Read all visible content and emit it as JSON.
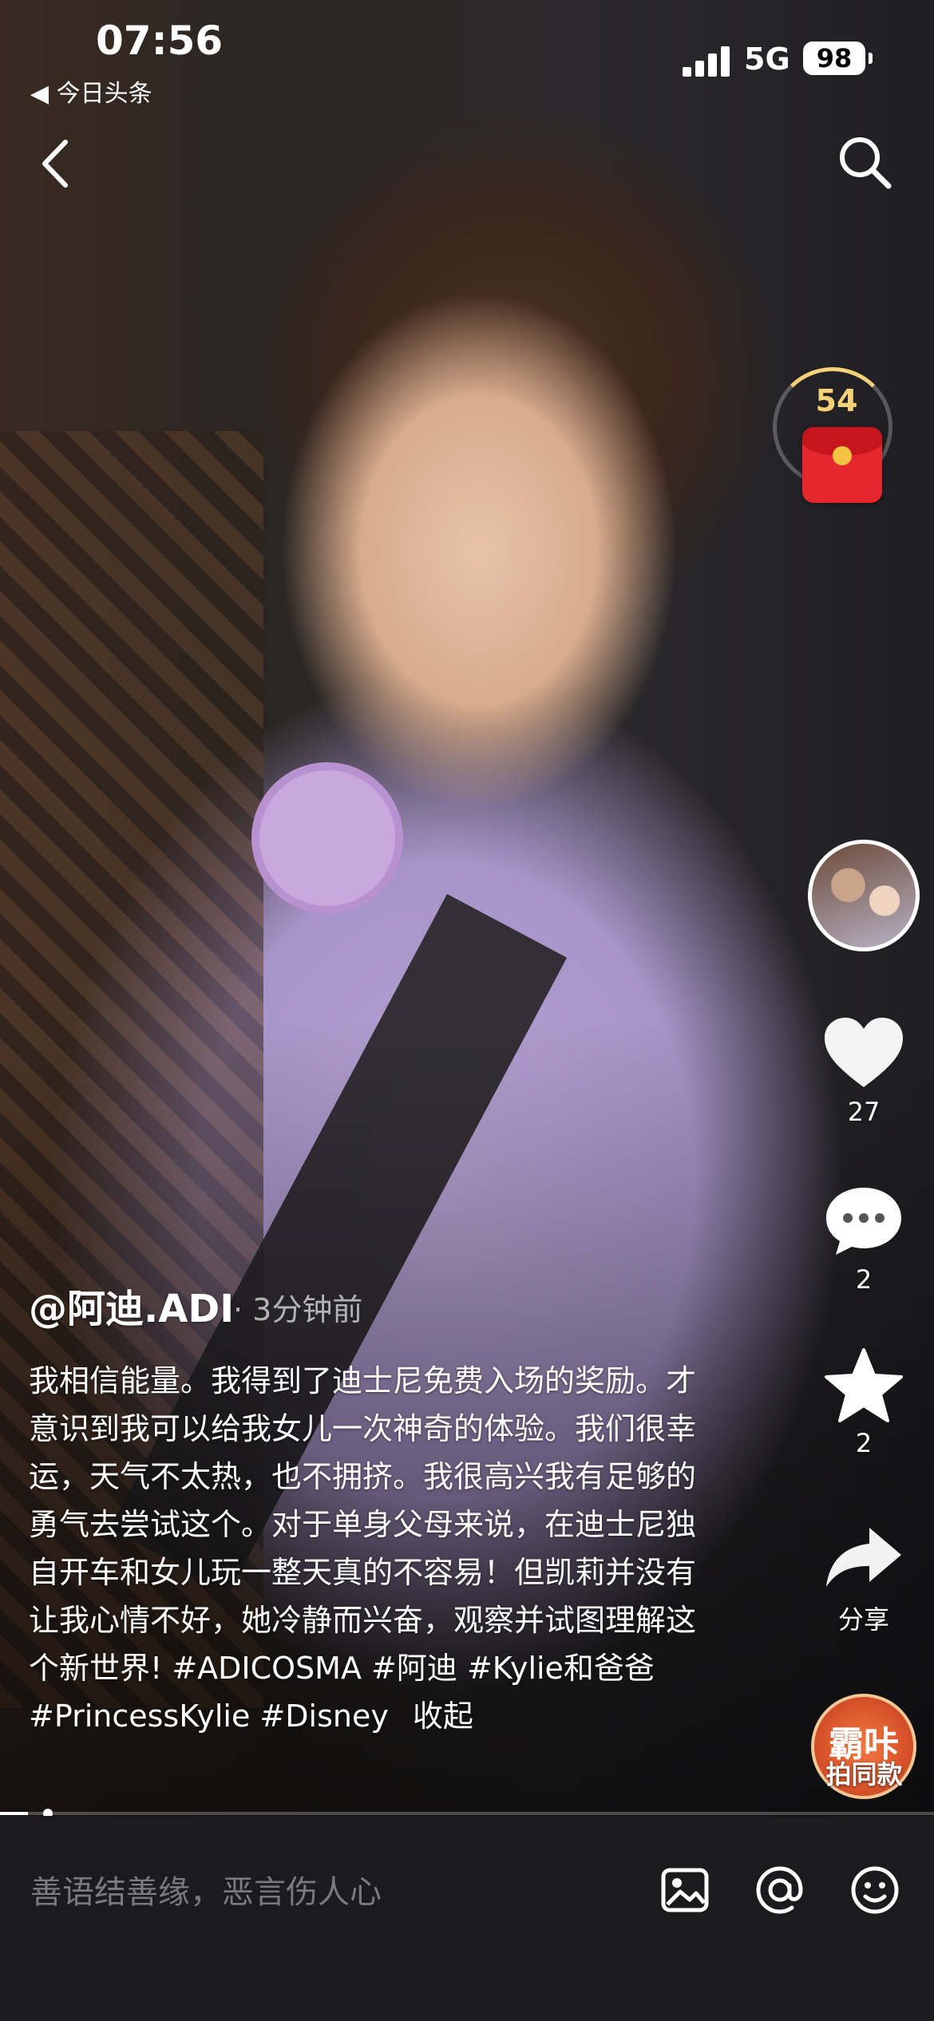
{
  "status_bar": {
    "time": "07:56",
    "back_app": "◀ 今日头条",
    "network": "5G",
    "battery": "98"
  },
  "red_packet": {
    "count": "54"
  },
  "post": {
    "author": "@阿迪.ADI",
    "time_ago": "· 3分钟前",
    "caption": "我相信能量。我得到了迪士尼免费入场的奖励。才意识到我可以给我女儿一次神奇的体验。我们很幸运，天气不太热，也不拥挤。我很高兴我有足够的勇气去尝试这个。对于单身父母来说，在迪士尼独自开车和女儿玩一整天真的不容易！但凯莉并没有让我心情不好，她冷静而兴奋，观察并试图理解这个新世界! #ADICOSMA #阿迪 #Kylie和爸爸 #PrincessKylie #Disney",
    "collapse_label": "收起"
  },
  "actions": {
    "like_count": "27",
    "comment_count": "2",
    "favorite_count": "2",
    "share_label": "分享",
    "make_same_badge": "霸咔",
    "make_same_label": "拍同款"
  },
  "playback": {
    "progress": 0.03
  },
  "comment_bar": {
    "placeholder": "善语结善缘，恶言伤人心"
  },
  "icons": [
    "back-arrow-icon",
    "search-icon",
    "heart-icon",
    "comment-icon",
    "star-icon",
    "share-icon",
    "image-icon",
    "at-icon",
    "emoji-icon"
  ]
}
